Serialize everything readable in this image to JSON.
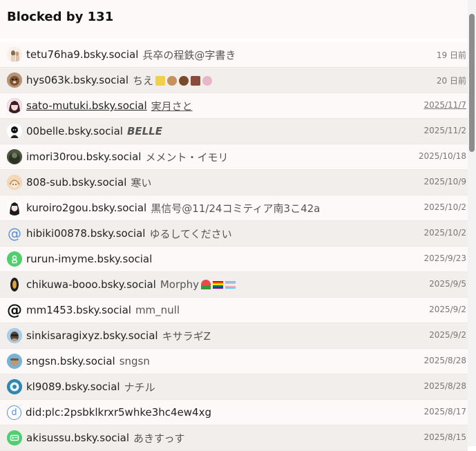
{
  "header": {
    "title": "Blocked by 131"
  },
  "rows": [
    {
      "handle": "tetu76ha9.bsky.social",
      "name": "兵卒の程鉄@字書き",
      "date": "19 日前",
      "avatar": "photo",
      "color": "#e9d7c9"
    },
    {
      "handle": "hys063k.bsky.social",
      "name": "ちえ",
      "date": "20 日前",
      "avatar": "photo",
      "color": "#8f6b45"
    },
    {
      "handle": "sato-mutuki.bsky.social",
      "name": "実月さと",
      "date": "2025/11/7",
      "avatar": "photo",
      "color": "#6a3b4a"
    },
    {
      "handle": "00belle.bsky.social",
      "name": "BELLE",
      "date": "2025/11/2",
      "avatar": "photo",
      "color": "#222222"
    },
    {
      "handle": "imori30rou.bsky.social",
      "name": "メメント・イモリ",
      "date": "2025/10/18",
      "avatar": "photo",
      "color": "#3f4a36"
    },
    {
      "handle": "808-sub.bsky.social",
      "name": "寒い",
      "date": "2025/10/9",
      "avatar": "photo",
      "color": "#d8b48a"
    },
    {
      "handle": "kuroiro2gou.bsky.social",
      "name": "黒信号@11/24コミティア南3こ42a",
      "date": "2025/10/2",
      "avatar": "photo",
      "color": "#2a2a2a"
    },
    {
      "handle": "hibiki00878.bsky.social",
      "name": "ゆるしてください",
      "date": "2025/10/2",
      "avatar": "at",
      "color": "#5b8fd6"
    },
    {
      "handle": "rurun-imyme.bsky.social",
      "name": "",
      "date": "2025/9/23",
      "avatar": "green",
      "color": "#4fcf6e"
    },
    {
      "handle": "chikuwa-booo.bsky.social",
      "name": "Morphy",
      "date": "2025/9/5",
      "avatar": "photo",
      "color": "#1d1d1d"
    },
    {
      "handle": "mm1453.bsky.social",
      "name": "mm_null",
      "date": "2025/9/2",
      "avatar": "at-black",
      "color": "#111111"
    },
    {
      "handle": "sinkisaragixyz.bsky.social",
      "name": "キサラギZ",
      "date": "2025/9/2",
      "avatar": "photo",
      "color": "#8fb7d8"
    },
    {
      "handle": "sngsn.bsky.social",
      "name": "sngsn",
      "date": "2025/8/28",
      "avatar": "photo",
      "color": "#6fa9c9"
    },
    {
      "handle": "kl9089.bsky.social",
      "name": "ナチル",
      "date": "2025/8/28",
      "avatar": "photo",
      "color": "#2f7fa6"
    },
    {
      "handle": "did:plc:2psbklkrxr5whke3hc4ew4xg",
      "name": "",
      "date": "2025/8/17",
      "avatar": "d",
      "color": "#5b8fd6"
    },
    {
      "handle": "akisussu.bsky.social",
      "name": "あきすっす",
      "date": "2025/8/15",
      "avatar": "green-card",
      "color": "#4fcf6e"
    }
  ]
}
